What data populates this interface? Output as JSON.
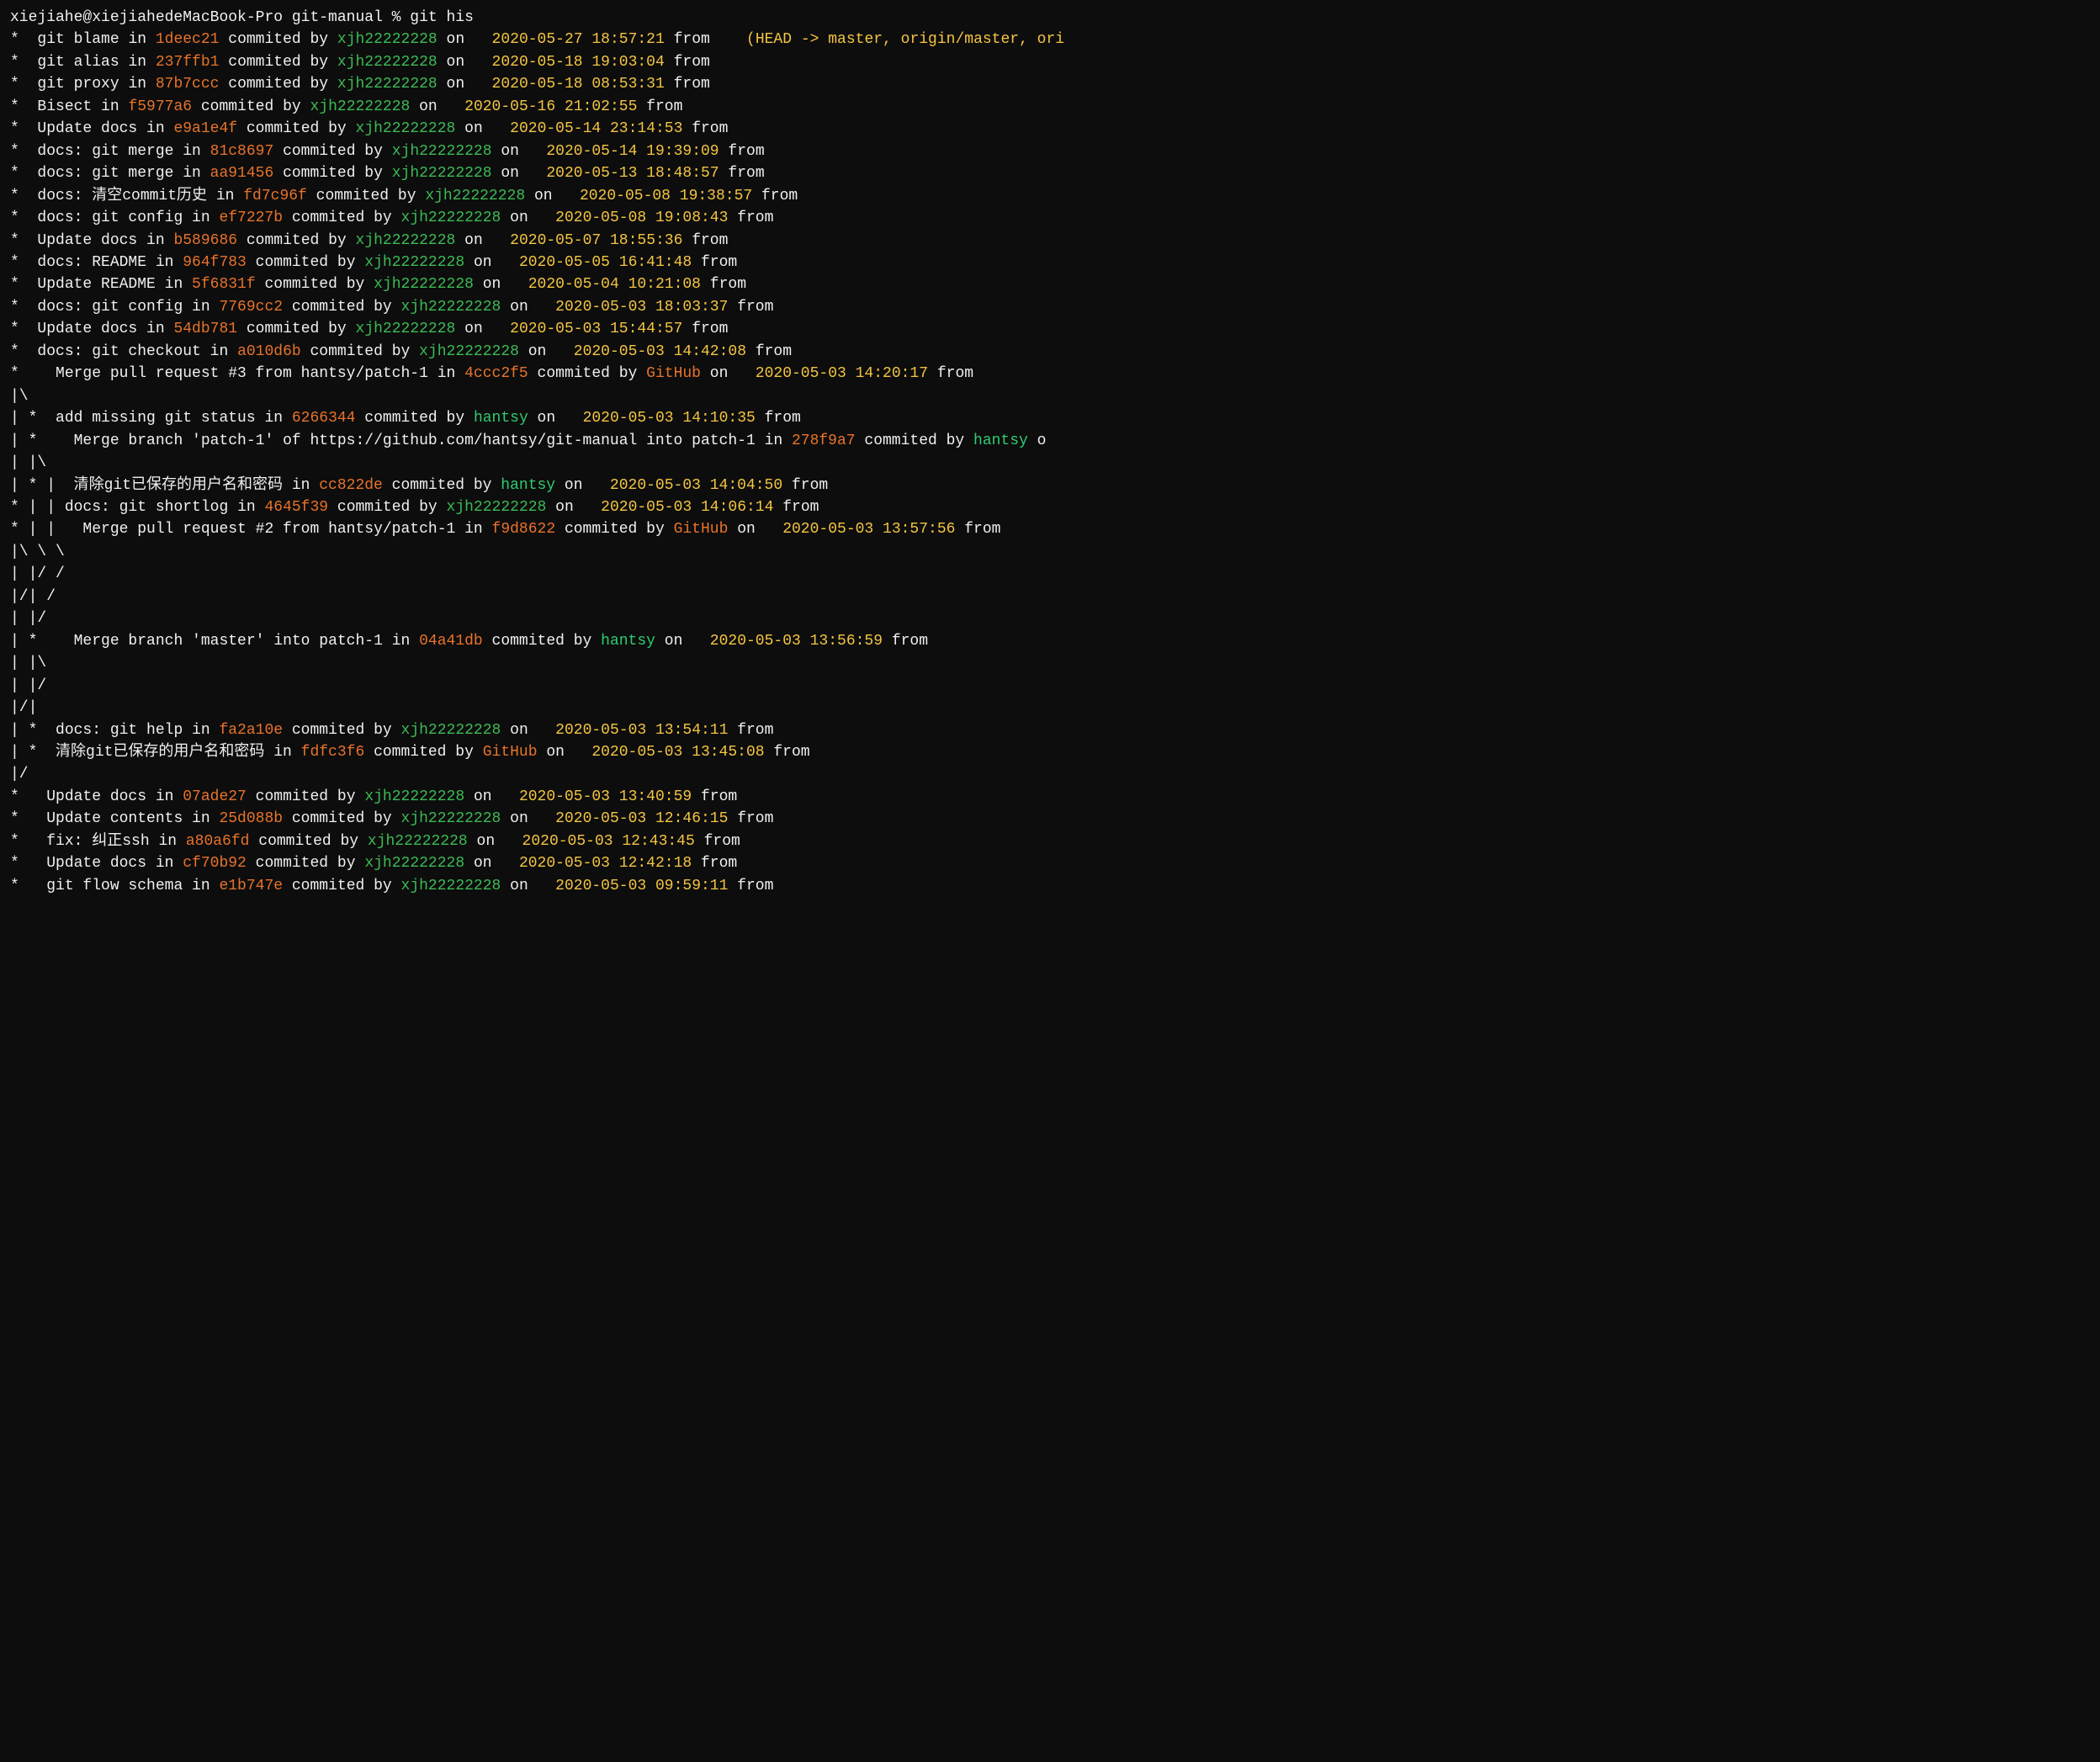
{
  "terminal": {
    "prompt": "xiejiahe@xiejiahedeMacBook-Pro git-manual % git his",
    "lines": [
      {
        "graph": "*",
        "msg": " git blame ",
        "in": "in",
        "hash": "1deec21",
        "committed": " commited by ",
        "author": "xjh22222228",
        "on": " on ",
        "date": " 2020-05-27 18:57:21",
        "from": " from",
        "extra": "    (HEAD -> master, origin/master, ori"
      },
      {
        "graph": "*",
        "msg": " git alias ",
        "in": "in",
        "hash": "237ffb1",
        "committed": " commited by ",
        "author": "xjh22222228",
        "on": " on ",
        "date": " 2020-05-18 19:03:04",
        "from": " from"
      },
      {
        "graph": "*",
        "msg": " git proxy ",
        "in": "in",
        "hash": "87b7ccc",
        "committed": " commited by ",
        "author": "xjh22222228",
        "on": " on ",
        "date": " 2020-05-18 08:53:31",
        "from": " from"
      },
      {
        "graph": "*",
        "msg": " Bisect ",
        "in": "in",
        "hash": "f5977a6",
        "committed": " commited by ",
        "author": "xjh22222228",
        "on": " on ",
        "date": " 2020-05-16 21:02:55",
        "from": " from"
      },
      {
        "graph": "*",
        "msg": " Update docs ",
        "in": "in",
        "hash": "e9a1e4f",
        "committed": " commited by ",
        "author": "xjh22222228",
        "on": " on ",
        "date": " 2020-05-14 23:14:53",
        "from": " from"
      },
      {
        "graph": "*",
        "msg": " docs: git merge ",
        "in": "in",
        "hash": "81c8697",
        "committed": " commited by ",
        "author": "xjh22222228",
        "on": " on ",
        "date": " 2020-05-14 19:39:09",
        "from": " from"
      },
      {
        "graph": "*",
        "msg": " docs: git merge ",
        "in": "in",
        "hash": "aa91456",
        "committed": " commited by ",
        "author": "xjh22222228",
        "on": " on ",
        "date": " 2020-05-13 18:48:57",
        "from": " from"
      },
      {
        "graph": "*",
        "msg": " docs: 清空commit历史 ",
        "in": "in",
        "hash": "fd7c96f",
        "committed": " commited by ",
        "author": "xjh22222228",
        "on": " on ",
        "date": " 2020-05-08 19:38:57",
        "from": " from"
      },
      {
        "graph": "*",
        "msg": " docs: git config ",
        "in": "in",
        "hash": "ef7227b",
        "committed": " commited by ",
        "author": "xjh22222228",
        "on": " on ",
        "date": " 2020-05-08 19:08:43",
        "from": " from"
      },
      {
        "graph": "*",
        "msg": " Update docs ",
        "in": "in",
        "hash": "b589686",
        "committed": " commited by ",
        "author": "xjh22222228",
        "on": " on ",
        "date": " 2020-05-07 18:55:36",
        "from": " from"
      },
      {
        "graph": "*",
        "msg": " docs: README ",
        "in": "in",
        "hash": "964f783",
        "committed": " commited by ",
        "author": "xjh22222228",
        "on": " on ",
        "date": " 2020-05-05 16:41:48",
        "from": " from"
      },
      {
        "graph": "*",
        "msg": " Update README ",
        "in": "in",
        "hash": "5f6831f",
        "committed": " commited by ",
        "author": "xjh22222228",
        "on": " on ",
        "date": " 2020-05-04 10:21:08",
        "from": " from"
      },
      {
        "graph": "*",
        "msg": " docs: git config ",
        "in": "in",
        "hash": "7769cc2",
        "committed": " commited by ",
        "author": "xjh22222228",
        "on": " on ",
        "date": " 2020-05-03 18:03:37",
        "from": " from"
      },
      {
        "graph": "*",
        "msg": " Update docs ",
        "in": "in",
        "hash": "54db781",
        "committed": " commited by ",
        "author": "xjh22222228",
        "on": " on ",
        "date": " 2020-05-03 15:44:57",
        "from": " from"
      },
      {
        "graph": "*",
        "msg": " docs: git checkout ",
        "in": "in",
        "hash": "a010d6b",
        "committed": " commited by ",
        "author": "xjh22222228",
        "on": " on ",
        "date": " 2020-05-03 14:42:08",
        "from": " from"
      },
      {
        "graph": "*",
        "msg": "   Merge pull request #3 from hantsy/patch-1 ",
        "in": "in",
        "hash": "4ccc2f5",
        "committed": " commited by ",
        "author": "GitHub",
        "on": " on ",
        "date": " 2020-05-03 14:20:17",
        "from": " from"
      },
      {
        "graph": "|\\",
        "msg": "",
        "raw": true
      },
      {
        "graph": "| *",
        "msg": " add missing git status ",
        "in": "in",
        "hash": "6266344",
        "committed": " commited by ",
        "author": "hantsy",
        "on": " on ",
        "date": " 2020-05-03 14:10:35",
        "from": " from",
        "author_type": "hantsy"
      },
      {
        "graph": "| *",
        "msg": "   Merge branch 'patch-1' of https://github.com/hantsy/git-manual into patch-1 ",
        "in": "in",
        "hash": "278f9a7",
        "committed": " commited by ",
        "author": "hantsy",
        "on": " on ",
        "date": "",
        "from": "",
        "author_type": "hantsy",
        "truncated": true
      },
      {
        "graph": "| |\\",
        "msg": "",
        "raw": true
      },
      {
        "graph": "| * |",
        "msg": "  清除git已保存的用户名和密码 ",
        "in": "in",
        "hash": "cc822de",
        "committed": " commited by ",
        "author": "hantsy",
        "on": " on ",
        "date": " 2020-05-03 14:04:50",
        "from": " from",
        "author_type": "hantsy"
      },
      {
        "graph": "* | |",
        "msg": " docs: git shortlog ",
        "in": "in",
        "hash": "4645f39",
        "committed": " commited by ",
        "author": "xjh22222228",
        "on": " on ",
        "date": " 2020-05-03 14:06:14",
        "from": " from"
      },
      {
        "graph": "* | |",
        "msg": "   Merge pull request #2 from hantsy/patch-1 ",
        "in": "in",
        "hash": "f9d8622",
        "committed": " commited by ",
        "author": "GitHub",
        "on": " on ",
        "date": " 2020-05-03 13:57:56",
        "from": " from"
      },
      {
        "graph": "|\\ \\ \\",
        "msg": "",
        "raw": true
      },
      {
        "graph": "| |/ /",
        "msg": "",
        "raw": true
      },
      {
        "graph": "|/| /",
        "msg": "",
        "raw": true
      },
      {
        "graph": "| |/",
        "msg": "",
        "raw": true
      },
      {
        "graph": "| *",
        "msg": "   Merge branch 'master' into patch-1 ",
        "in": "in",
        "hash": "04a41db",
        "committed": " commited by ",
        "author": "hantsy",
        "on": " on ",
        "date": " 2020-05-03 13:56:59",
        "from": " from",
        "author_type": "hantsy"
      },
      {
        "graph": "| |\\",
        "msg": "",
        "raw": true
      },
      {
        "graph": "| |/",
        "msg": "",
        "raw": true
      },
      {
        "graph": "|/|",
        "msg": "",
        "raw": true
      },
      {
        "graph": "| *",
        "msg": "  docs: git help ",
        "in": "in",
        "hash": "fa2a10e",
        "committed": " commited by ",
        "author": "xjh22222228",
        "on": " on ",
        "date": " 2020-05-03 13:54:11",
        "from": " from"
      },
      {
        "graph": "| *",
        "msg": "  清除git已保存的用户名和密码 ",
        "in": "in",
        "hash": "fdfc3f6",
        "committed": " commited by ",
        "author": "GitHub",
        "on": " on ",
        "date": " 2020-05-03 13:45:08",
        "from": " from",
        "author_type": "github"
      },
      {
        "graph": "|/",
        "msg": "",
        "raw": true
      },
      {
        "graph": "*",
        "msg": "  Update docs ",
        "in": "in",
        "hash": "07ade27",
        "committed": " commited by ",
        "author": "xjh22222228",
        "on": " on ",
        "date": " 2020-05-03 13:40:59",
        "from": " from"
      },
      {
        "graph": "*",
        "msg": "  Update contents ",
        "in": "in",
        "hash": "25d088b",
        "committed": " commited by ",
        "author": "xjh22222228",
        "on": " on ",
        "date": " 2020-05-03 12:46:15",
        "from": " from"
      },
      {
        "graph": "*",
        "msg": "  fix: 纠正ssh ",
        "in": "in",
        "hash": "a80a6fd",
        "committed": " commited by ",
        "author": "xjh22222228",
        "on": " on ",
        "date": " 2020-05-03 12:43:45",
        "from": " from"
      },
      {
        "graph": "*",
        "msg": "  Update docs ",
        "in": "in",
        "hash": "cf70b92",
        "committed": " commited by ",
        "author": "xjh22222228",
        "on": " on ",
        "date": " 2020-05-03 12:42:18",
        "from": " from"
      },
      {
        "graph": "*",
        "msg": "  git flow schema ",
        "in": "in",
        "hash": "e1b747e",
        "committed": " commited by ",
        "author": "xjh22222228",
        "on": " on ",
        "date": " 2020-05-03 09:59:11",
        "from": " from"
      }
    ]
  }
}
